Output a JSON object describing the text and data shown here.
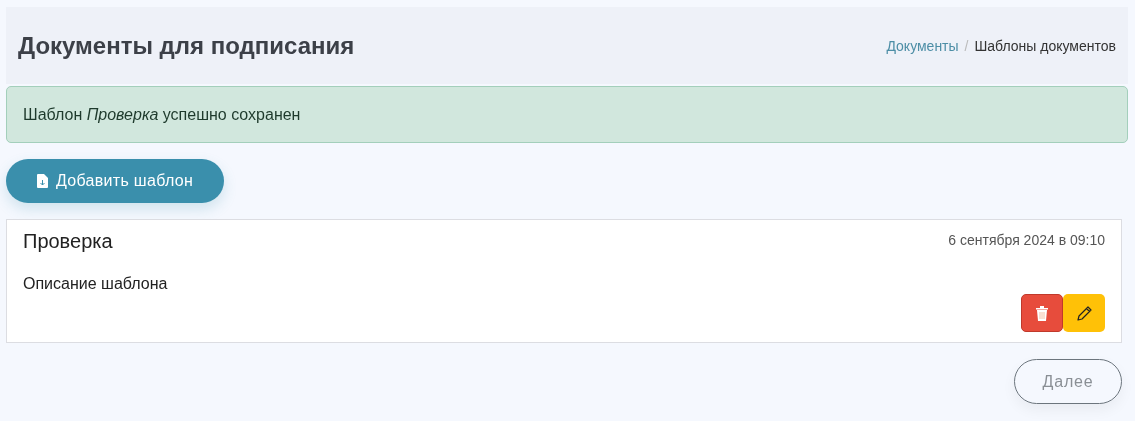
{
  "header": {
    "title": "Документы для подписания",
    "separator": "/",
    "breadcrumbs": [
      {
        "label": "Документы",
        "link": true
      },
      {
        "label": "Шаблоны документов",
        "link": false
      }
    ]
  },
  "alert": {
    "message": "Шаблон *Проверка* успешно сохранен"
  },
  "add_button": {
    "label": "Добавить шаблон"
  },
  "templates": [
    {
      "name": "Проверка",
      "date": "6 сентября 2024 в 09:10",
      "description": "Описание шаблона"
    }
  ],
  "next_button": {
    "label": "Далее",
    "disabled": true
  }
}
